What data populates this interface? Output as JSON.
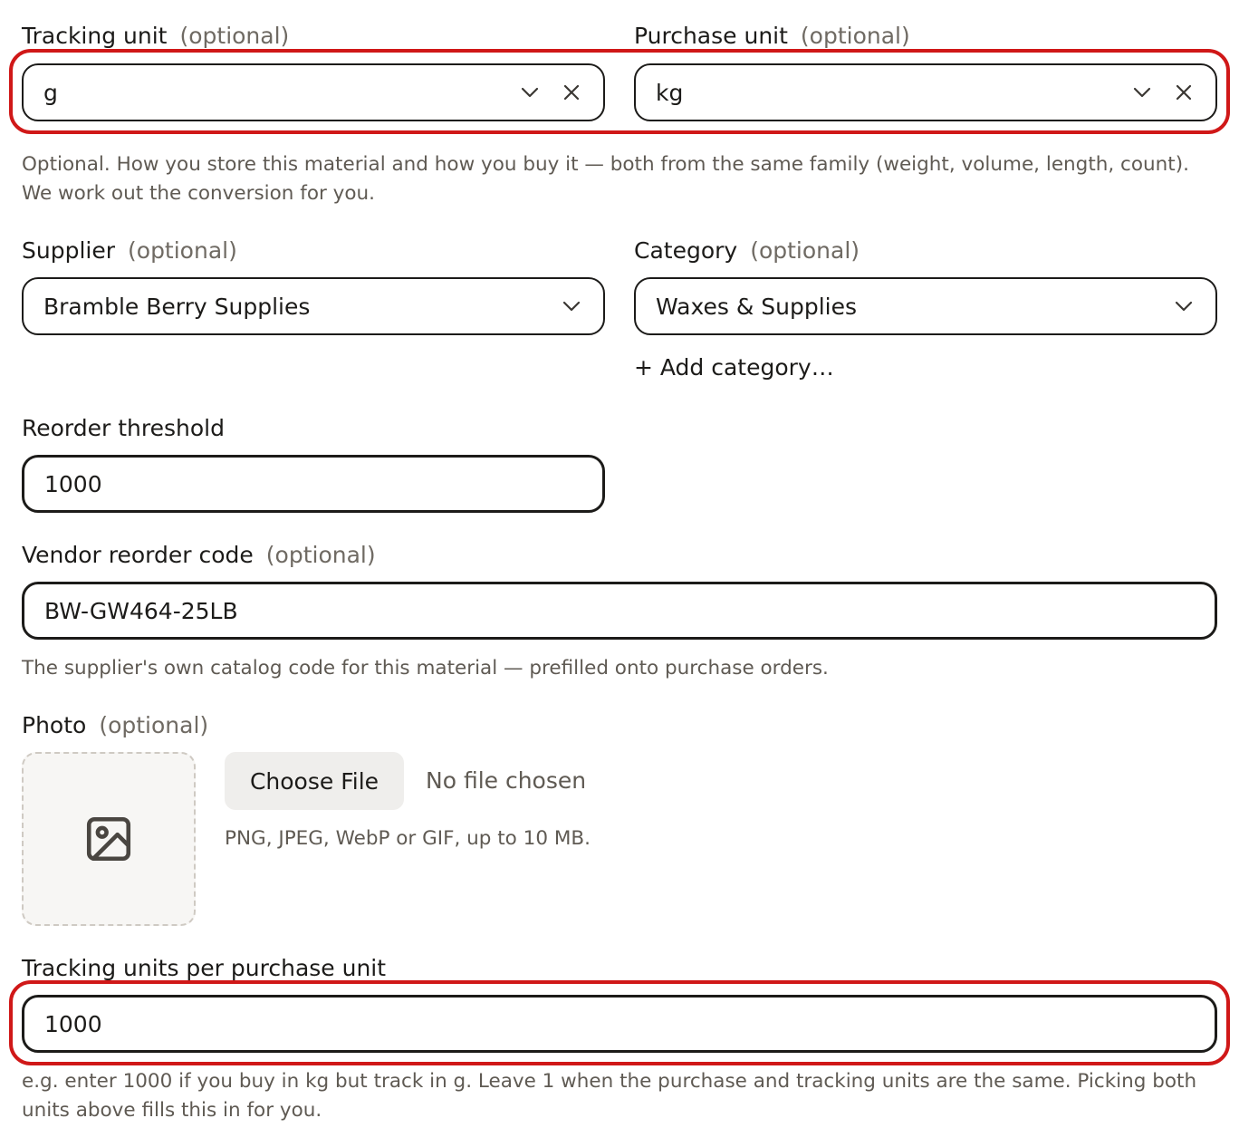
{
  "tracking_unit": {
    "label": "Tracking unit",
    "optional": "(optional)",
    "value": "g",
    "icons": [
      "chevron-down-icon",
      "close-icon"
    ]
  },
  "purchase_unit": {
    "label": "Purchase unit",
    "optional": "(optional)",
    "value": "kg",
    "icons": [
      "chevron-down-icon",
      "close-icon"
    ]
  },
  "units_help": "Optional. How you store this material and how you buy it — both from the same family (weight, volume, length, count). We work out the conversion for you.",
  "supplier": {
    "label": "Supplier",
    "optional": "(optional)",
    "value": "Bramble Berry Supplies"
  },
  "category": {
    "label": "Category",
    "optional": "(optional)",
    "value": "Waxes & Supplies",
    "add_label": "+ Add category…"
  },
  "reorder_threshold": {
    "label": "Reorder threshold",
    "value": "1000"
  },
  "vendor_code": {
    "label": "Vendor reorder code",
    "optional": "(optional)",
    "value": "BW-GW464-25LB",
    "help": "The supplier's own catalog code for this material — prefilled onto purchase orders."
  },
  "photo": {
    "label": "Photo",
    "optional": "(optional)",
    "choose_label": "Choose File",
    "no_file": "No file chosen",
    "help": "PNG, JPEG, WebP or GIF, up to 10 MB.",
    "placeholder_icon": "image-icon"
  },
  "conversion": {
    "label": "Tracking units per purchase unit",
    "value": "1000",
    "help": "e.g. enter 1000 if you buy in kg but track in g. Leave 1 when the purchase and tracking units are the same. Picking both units above fills this in for you."
  },
  "colors": {
    "highlight": "#d01818",
    "text": "#1c1b19",
    "muted": "#5f5a53"
  }
}
